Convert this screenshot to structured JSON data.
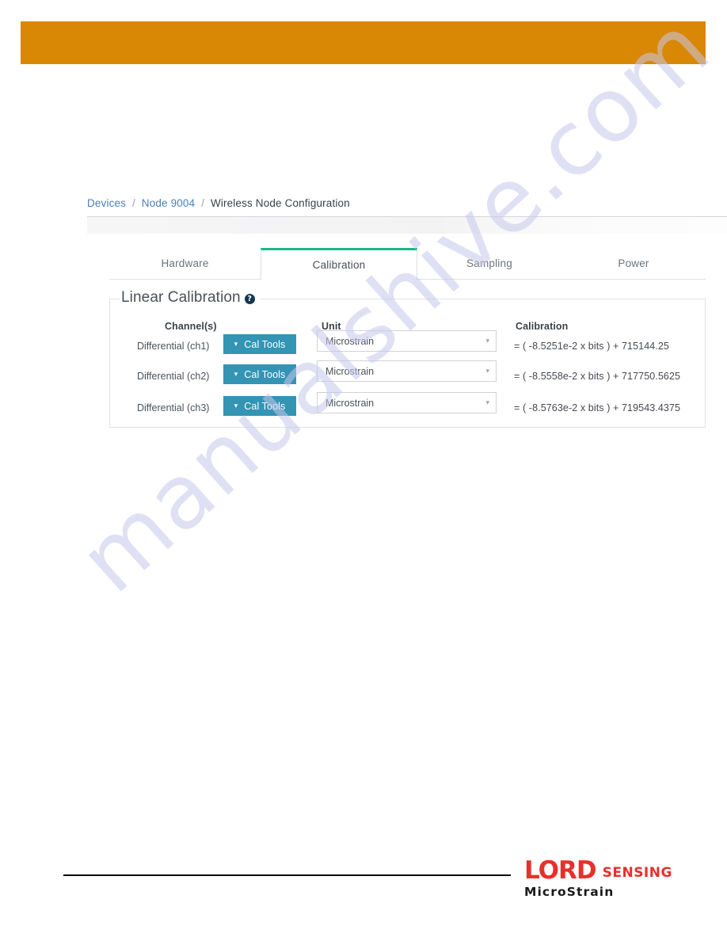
{
  "colors": {
    "header_band": "#d98806",
    "accent_tab_active": "#1bb78a",
    "cal_tools_button": "#3394b4",
    "breadcrumb_link": "#4a7fb5",
    "help_icon": "#10394f",
    "logo_red": "#e8302a",
    "watermark": "#c8c8ec"
  },
  "watermark": {
    "text": "manualshive.com"
  },
  "breadcrumb": {
    "items": [
      {
        "label": "Devices",
        "link": true
      },
      {
        "label": "Node 9004",
        "link": true
      },
      {
        "label": "Wireless Node Configuration",
        "link": false
      }
    ],
    "separator": "/"
  },
  "tabs": [
    {
      "label": "Hardware",
      "active": false
    },
    {
      "label": "Calibration",
      "active": true
    },
    {
      "label": "Sampling",
      "active": false
    },
    {
      "label": "Power",
      "active": false
    }
  ],
  "panel": {
    "legend": "Linear Calibration",
    "help_icon": "?",
    "columns": {
      "channel": "Channel(s)",
      "unit": "Unit",
      "calibration": "Calibration"
    },
    "cal_tools_label": "Cal Tools",
    "cal_tools_caret": "▾",
    "select_arrow": "▾",
    "rows": [
      {
        "channel": "Differential (ch1)",
        "cal_tools": "Cal Tools",
        "unit": "Microstrain",
        "calibration": "= ( -8.5251e-2 x bits ) + 715144.25"
      },
      {
        "channel": "Differential (ch2)",
        "cal_tools": "Cal Tools",
        "unit": "Microstrain",
        "calibration": "= ( -8.5558e-2 x bits ) + 717750.5625"
      },
      {
        "channel": "Differential (ch3)",
        "cal_tools": "Cal Tools",
        "unit": "Microstrain",
        "calibration": "= ( -8.5763e-2 x bits ) + 719543.4375"
      }
    ]
  },
  "footer": {
    "logo": {
      "brand": "LORD",
      "sub_brand": "SENSING",
      "division": "MicroStrain"
    }
  }
}
